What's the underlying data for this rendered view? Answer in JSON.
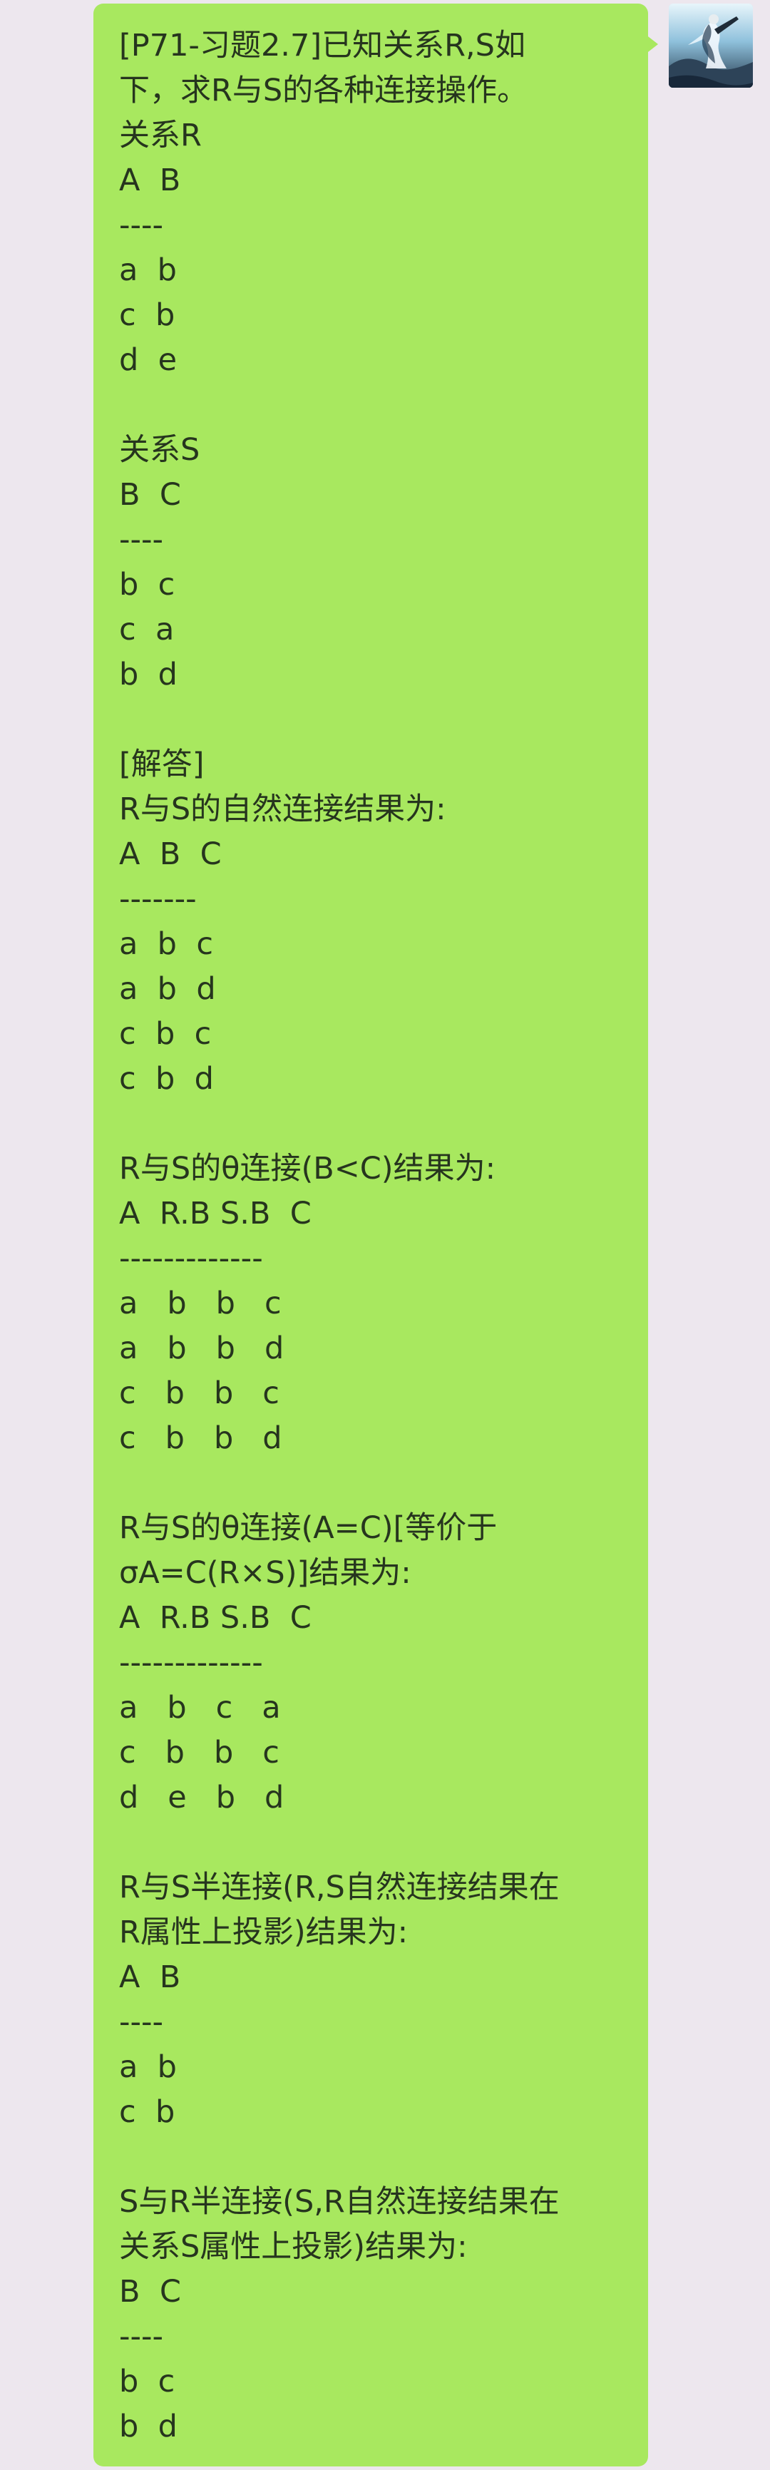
{
  "conversation": {
    "message": {
      "lines": [
        "[P71-习题2.7]已知关系R,S如",
        "下，求R与S的各种连接操作。",
        "关系R",
        "A  B",
        "----",
        "a  b",
        "c  b",
        "d  e",
        "",
        "关系S",
        "B  C",
        "----",
        "b  c",
        "c  a",
        "b  d",
        "",
        "[解答]",
        "R与S的自然连接结果为:",
        "A  B  C",
        "-------",
        "a  b  c",
        "a  b  d",
        "c  b  c",
        "c  b  d",
        "",
        "R与S的θ连接(B<C)结果为:",
        "A  R.B S.B  C",
        "-------------",
        "a   b   b   c",
        "a   b   b   d",
        "c   b   b   c",
        "c   b   b   d",
        "",
        "R与S的θ连接(A=C)[等价于",
        "σA=C(R×S)]结果为:",
        "A  R.B S.B  C",
        "-------------",
        "a   b   c   a",
        "c   b   b   c",
        "d   e   b   d",
        "",
        "R与S半连接(R,S自然连接结果在",
        "R属性上投影)结果为:",
        "A  B",
        "----",
        "a  b",
        "c  b",
        "",
        "S与R半连接(S,R自然连接结果在",
        "关系S属性上投影)结果为:",
        "B  C",
        "----",
        "b  c",
        "b  d"
      ]
    },
    "avatar": {
      "icon": "avatar-image"
    },
    "colors": {
      "background": "#ede7ee",
      "bubble": "#a8e85f",
      "text": "#26351e"
    }
  }
}
